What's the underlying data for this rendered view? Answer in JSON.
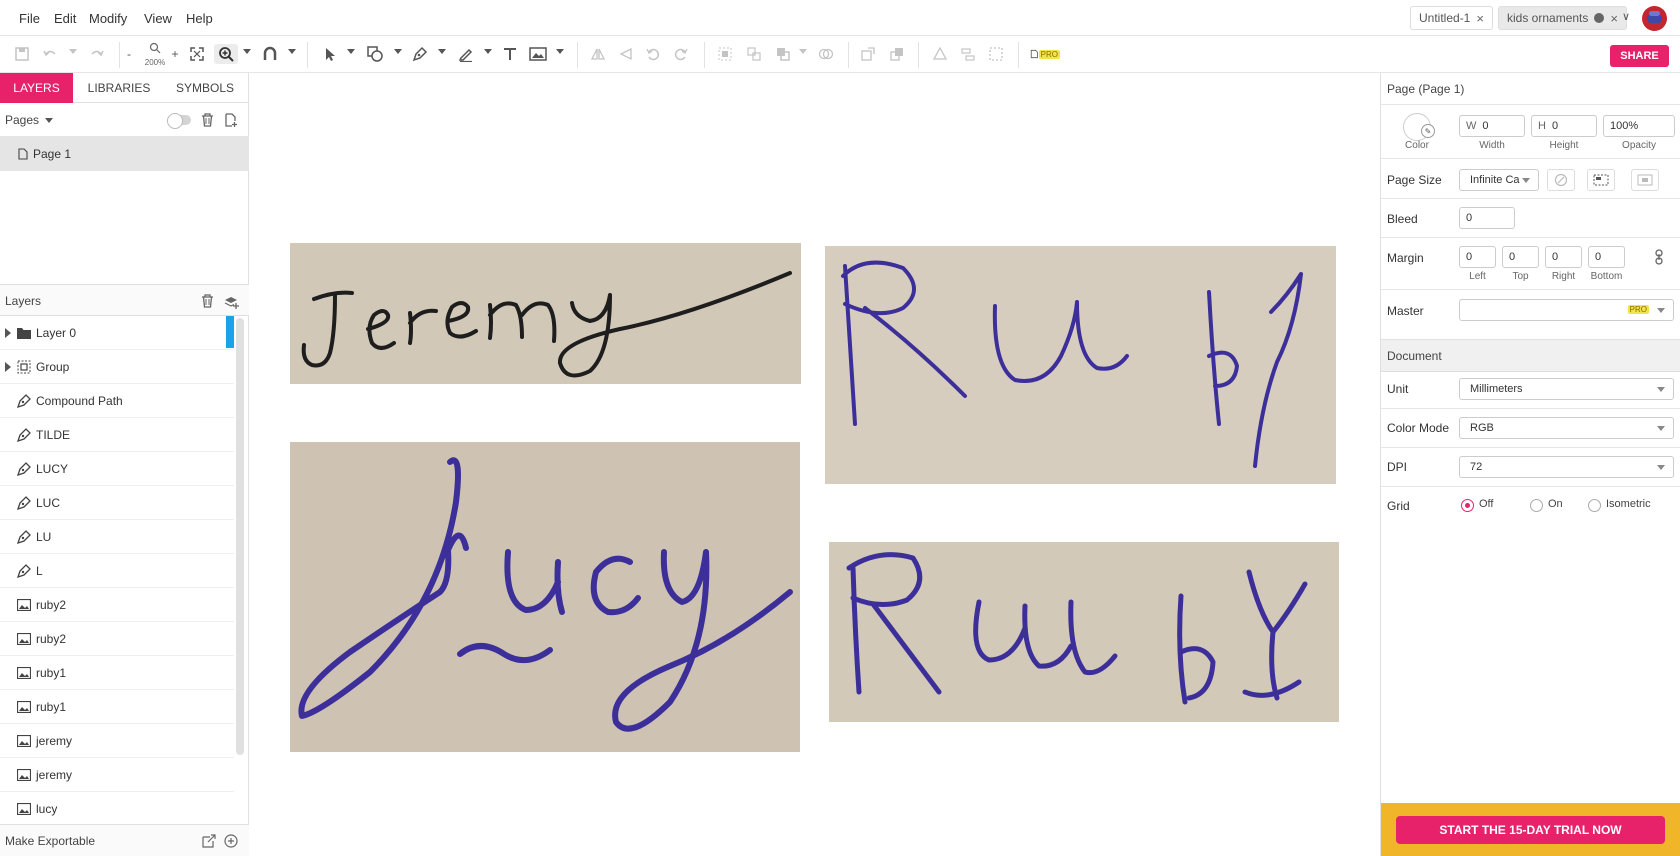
{
  "menu": [
    "File",
    "Edit",
    "Modify",
    "View",
    "Help"
  ],
  "doc_tabs": [
    {
      "label": "Untitled-1",
      "close": "×"
    },
    {
      "label": "kids ornaments",
      "close": "×"
    }
  ],
  "toolbar": {
    "zoom_level": "200%",
    "zoom_minus": "-",
    "zoom_plus": "+",
    "pro_label": "PRO",
    "share_label": "SHARE"
  },
  "left_panel": {
    "tabs": [
      "LAYERS",
      "LIBRARIES",
      "SYMBOLS"
    ],
    "pages_label": "Pages",
    "pages": [
      "Page 1"
    ],
    "layers_label": "Layers",
    "layers": [
      {
        "name": "Layer 0",
        "icon": "folder-icon",
        "expandable": true
      },
      {
        "name": "Group",
        "icon": "group-icon",
        "expandable": true
      },
      {
        "name": "Compound Path",
        "icon": "pen-path-icon",
        "expandable": false
      },
      {
        "name": "TILDE",
        "icon": "pen-path-icon",
        "expandable": false
      },
      {
        "name": "LUCY",
        "icon": "pen-path-icon",
        "expandable": false
      },
      {
        "name": "LUC",
        "icon": "pen-path-icon",
        "expandable": false
      },
      {
        "name": "LU",
        "icon": "pen-path-icon",
        "expandable": false
      },
      {
        "name": "L",
        "icon": "pen-path-icon",
        "expandable": false
      },
      {
        "name": "ruby2",
        "icon": "image-icon",
        "expandable": false
      },
      {
        "name": "ruby2",
        "icon": "image-icon",
        "expandable": false
      },
      {
        "name": "ruby1",
        "icon": "image-icon",
        "expandable": false
      },
      {
        "name": "ruby1",
        "icon": "image-icon",
        "expandable": false
      },
      {
        "name": "jeremy",
        "icon": "image-icon",
        "expandable": false
      },
      {
        "name": "jeremy",
        "icon": "image-icon",
        "expandable": false
      },
      {
        "name": "lucy",
        "icon": "image-icon",
        "expandable": false
      }
    ],
    "make_exportable": "Make Exportable"
  },
  "canvas": {
    "images": [
      {
        "name": "jeremy",
        "ink": "#1e1e1e"
      },
      {
        "name": "ruby1",
        "ink": "#3d2f9a"
      },
      {
        "name": "lucy",
        "ink": "#3d2f9a"
      },
      {
        "name": "ruby2",
        "ink": "#3d2f9a"
      }
    ]
  },
  "right_panel": {
    "title": "Page (Page 1)",
    "color_label": "Color",
    "width_prefix": "W",
    "width_value": "0",
    "width_label": "Width",
    "height_prefix": "H",
    "height_value": "0",
    "height_label": "Height",
    "opacity_value": "100%",
    "opacity_label": "Opacity",
    "page_size_label": "Page Size",
    "page_size_value": "Infinite Ca",
    "bleed_label": "Bleed",
    "bleed_value": "0",
    "margin_label": "Margin",
    "margin": [
      {
        "label": "Left",
        "value": "0"
      },
      {
        "label": "Top",
        "value": "0"
      },
      {
        "label": "Right",
        "value": "0"
      },
      {
        "label": "Bottom",
        "value": "0"
      }
    ],
    "master_label": "Master",
    "master_pro": "PRO",
    "document_label": "Document",
    "unit_label": "Unit",
    "unit_value": "Millimeters",
    "color_mode_label": "Color Mode",
    "color_mode_value": "RGB",
    "dpi_label": "DPI",
    "dpi_value": "72",
    "grid_label": "Grid",
    "grid_options": [
      "Off",
      "On",
      "Isometric"
    ],
    "grid_selected": "Off",
    "trial_button": "START THE 15-DAY TRIAL NOW"
  },
  "colors": {
    "accent": "#e8216b",
    "trial_bar": "#f0b528",
    "selection_blue": "#1aa3e8"
  }
}
